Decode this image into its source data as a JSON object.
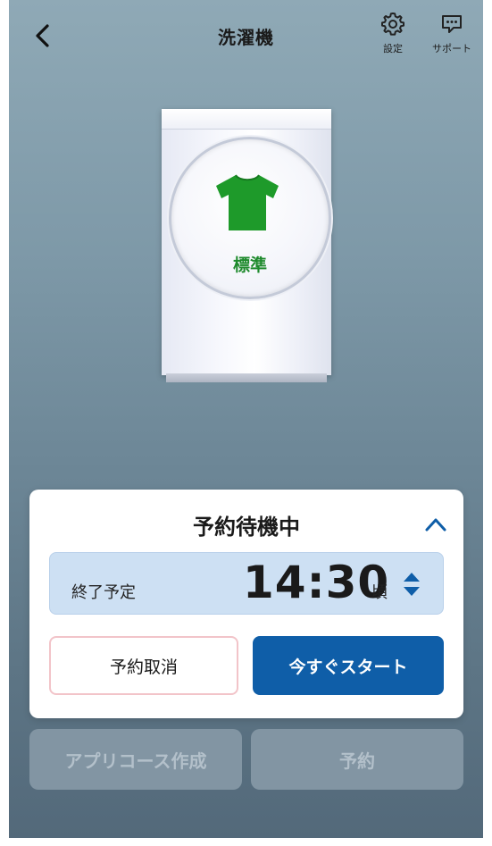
{
  "header": {
    "title": "洗濯機",
    "settings_label": "設定",
    "support_label": "サポート"
  },
  "washer": {
    "course_name": "標準",
    "course_icon": "t-shirt-icon",
    "icon_color": "#1e9a2a"
  },
  "reservation_card": {
    "status_title": "予約待機中",
    "end_time_label": "終了予定",
    "end_time_value": "14:30",
    "end_time_suffix": "頃",
    "cancel_label": "予約取消",
    "start_now_label": "今すぐスタート"
  },
  "bottom_actions": {
    "create_app_course_label": "アプリコース作成",
    "reserve_label": "予約"
  },
  "colors": {
    "primary": "#0f5ea8",
    "end_time_bg": "#cde0f3",
    "cancel_border": "#f2c4c9",
    "course_green": "#1e8a2c"
  }
}
